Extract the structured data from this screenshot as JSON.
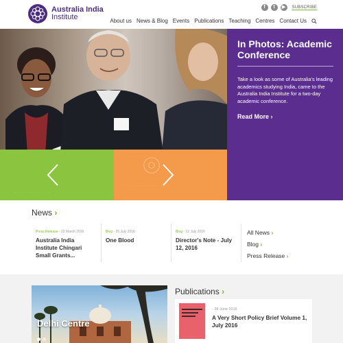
{
  "header": {
    "logo_line1": "Australia India",
    "logo_line2": "Institute",
    "subscribe": "SUBSCRIBE",
    "social": [
      "facebook-icon",
      "twitter-icon",
      "youtube-icon"
    ],
    "nav": [
      "About us",
      "News & Blog",
      "Events",
      "Publications",
      "Teaching",
      "Centres",
      "Contact Us"
    ]
  },
  "hero": {
    "title": "In Photos: Academic Conference",
    "description": "Take a look as some of Australia's leading academics studying India, came to the Australia India Institute for a two-day academic conference.",
    "read_more": "Read More",
    "panel_color": "#5b2d8e",
    "green_color": "#8bc53f",
    "orange_color": "#f39a4b"
  },
  "news": {
    "heading": "News",
    "items": [
      {
        "category": "Press Release",
        "date": "22 March 2016",
        "title": "Australia India Institute Chingari Small Grants..."
      },
      {
        "category": "Blog",
        "date": "25 July 2016",
        "title": "One Blood"
      },
      {
        "category": "Blog",
        "date": "12 July 2016",
        "title": "Director's Note - July 12, 2016"
      }
    ],
    "links": [
      "All News",
      "Blog",
      "Press Release"
    ]
  },
  "centre": {
    "label": "Delhi Centre"
  },
  "publications": {
    "heading": "Publications",
    "item": {
      "date": "28 June 2016",
      "title": "A Very Short Policy Brief Volume 1, July 2016"
    }
  },
  "colors": {
    "accent_green": "#7db82f",
    "brand_purple": "#4b2c83"
  }
}
